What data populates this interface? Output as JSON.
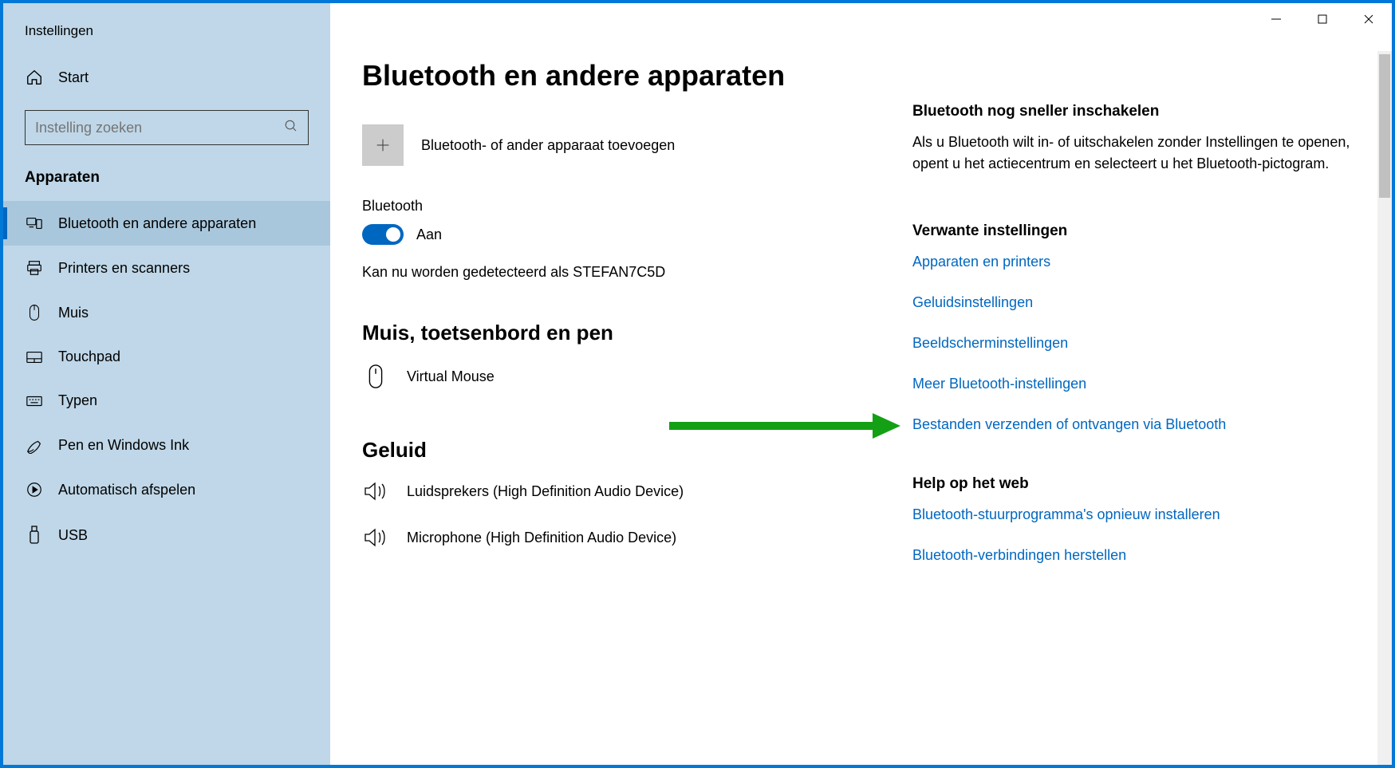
{
  "app_title": "Instellingen",
  "home_label": "Start",
  "search": {
    "placeholder": "Instelling zoeken"
  },
  "section_label": "Apparaten",
  "nav": [
    {
      "label": "Bluetooth en andere apparaten",
      "icon": "devices"
    },
    {
      "label": "Printers en scanners",
      "icon": "printer"
    },
    {
      "label": "Muis",
      "icon": "mouse"
    },
    {
      "label": "Touchpad",
      "icon": "touchpad"
    },
    {
      "label": "Typen",
      "icon": "keyboard"
    },
    {
      "label": "Pen en Windows Ink",
      "icon": "pen"
    },
    {
      "label": "Automatisch afspelen",
      "icon": "autoplay"
    },
    {
      "label": "USB",
      "icon": "usb"
    }
  ],
  "page_title": "Bluetooth en andere apparaten",
  "add_device_label": "Bluetooth- of ander apparaat toevoegen",
  "bluetooth": {
    "label": "Bluetooth",
    "state_label": "Aan",
    "status": "Kan nu worden gedetecteerd als STEFAN7C5D"
  },
  "categories": [
    {
      "heading": "Muis, toetsenbord en pen",
      "devices": [
        {
          "label": "Virtual Mouse",
          "icon": "mouse"
        }
      ]
    },
    {
      "heading": "Geluid",
      "devices": [
        {
          "label": "Luidsprekers (High Definition Audio Device)",
          "icon": "speaker"
        },
        {
          "label": "Microphone (High Definition Audio Device)",
          "icon": "speaker"
        }
      ]
    }
  ],
  "side": {
    "quick": {
      "heading": "Bluetooth nog sneller inschakelen",
      "text": "Als u Bluetooth wilt in- of uitschakelen zonder Instellingen te openen, opent u het actiecentrum en selecteert u het Bluetooth-pictogram."
    },
    "related": {
      "heading": "Verwante instellingen",
      "links": [
        "Apparaten en printers",
        "Geluidsinstellingen",
        "Beeldscherminstellingen",
        "Meer Bluetooth-instellingen",
        "Bestanden verzenden of ontvangen via Bluetooth"
      ]
    },
    "help": {
      "heading": "Help op het web",
      "links": [
        "Bluetooth-stuurprogramma's opnieuw installeren",
        "Bluetooth-verbindingen herstellen"
      ]
    }
  }
}
